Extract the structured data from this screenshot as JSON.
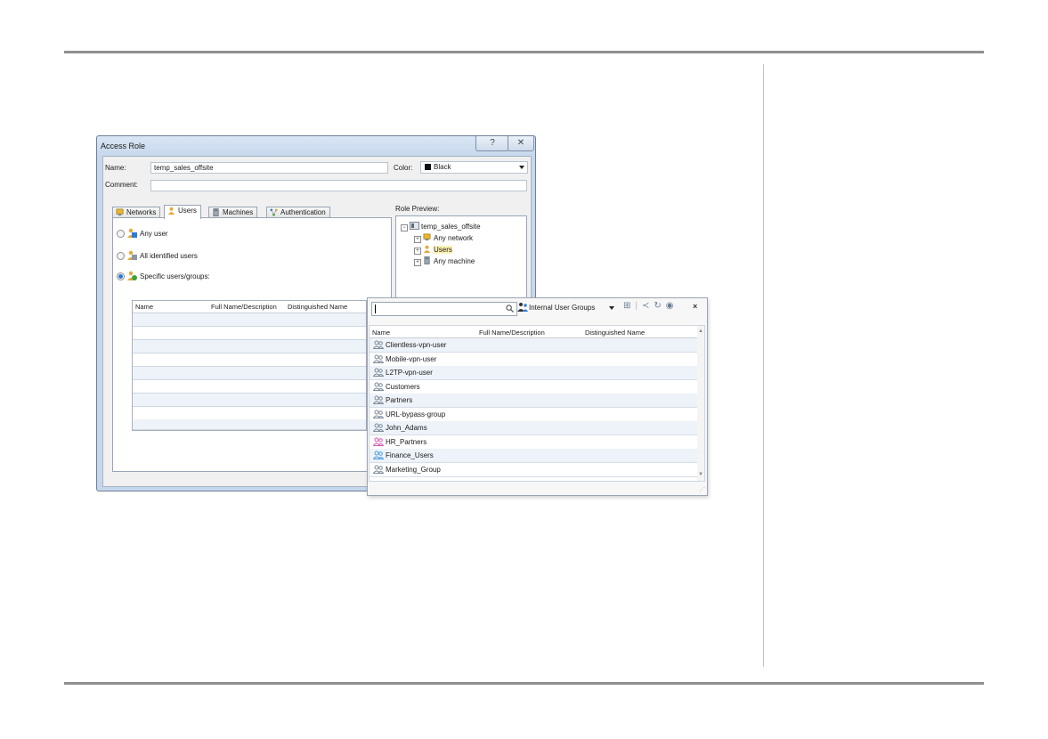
{
  "dialog": {
    "title": "Access Role",
    "help_glyph": "?",
    "close_glyph": "✕",
    "name_label": "Name:",
    "name_value": "temp_sales_offsite",
    "comment_label": "Comment:",
    "comment_value": "",
    "color_label": "Color:",
    "color_value": "Black",
    "color_swatch": "#111111",
    "tabs": [
      {
        "label": "Networks",
        "icon": "network-icon"
      },
      {
        "label": "Users",
        "icon": "users-icon",
        "active": true
      },
      {
        "label": "Machines",
        "icon": "machine-icon"
      },
      {
        "label": "Authentication",
        "icon": "authentication-icon"
      }
    ],
    "radios": [
      {
        "label": "Any user",
        "checked": false
      },
      {
        "label": "All identified users",
        "checked": false
      },
      {
        "label": "Specific users/groups:",
        "checked": true
      }
    ],
    "grid_headers": [
      "Name",
      "Full Name/Description",
      "Distinguished Name"
    ],
    "add_glyph": "+",
    "preview_label": "Role Preview:",
    "preview_tree": {
      "root": "temp_sales_offsite",
      "children": [
        "Any network",
        "Users",
        "Any machine"
      ]
    }
  },
  "picker": {
    "search_value": "",
    "search_icon": "search-icon",
    "group_select": "Internal User Groups",
    "close_glyph": "×",
    "headers": [
      "Name",
      "Full Name/Description",
      "Distinguished Name"
    ],
    "items": [
      {
        "name": "Clientless-vpn-user",
        "icon_color": "#7c8a99"
      },
      {
        "name": "Mobile-vpn-user",
        "icon_color": "#7c8a99"
      },
      {
        "name": "L2TP-vpn-user",
        "icon_color": "#7c8a99"
      },
      {
        "name": "Customers",
        "icon_color": "#7c8a99"
      },
      {
        "name": "Partners",
        "icon_color": "#7c8a99"
      },
      {
        "name": "URL-bypass-group",
        "icon_color": "#7c8a99"
      },
      {
        "name": "John_Adams",
        "icon_color": "#7c8a99"
      },
      {
        "name": "HR_Partners",
        "icon_color": "#d65ab8"
      },
      {
        "name": "Finance_Users",
        "icon_color": "#4a9be0"
      },
      {
        "name": "Marketing_Group",
        "icon_color": "#7c8a99"
      }
    ]
  },
  "colors": {
    "dialog_frame": "#c6d7ec",
    "selection_blue": "#2b7bd6",
    "add_green": "#3aa33a"
  }
}
